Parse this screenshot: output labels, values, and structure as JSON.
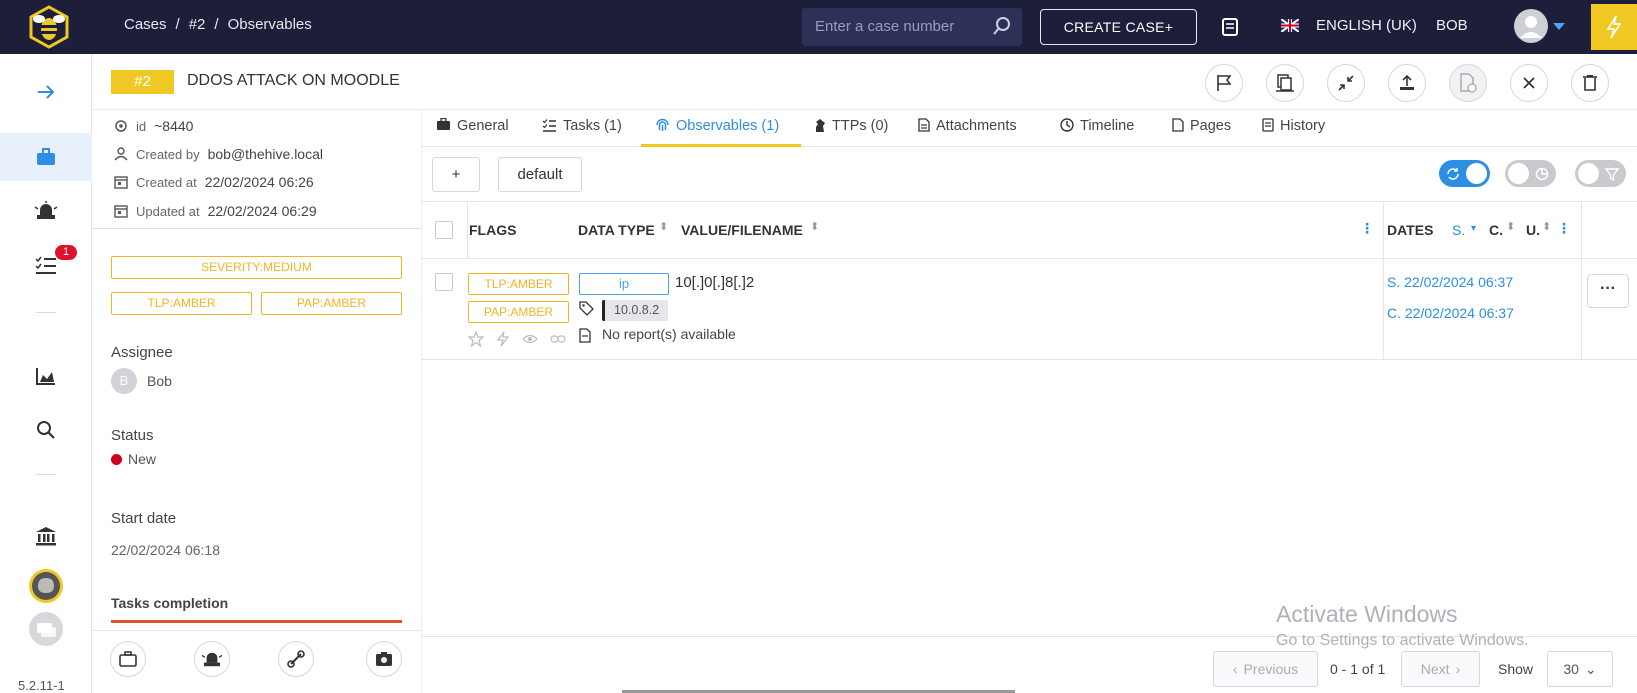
{
  "topbar": {
    "breadcrumb": [
      "Cases",
      "/",
      "#2",
      "/",
      "Observables"
    ],
    "search_placeholder": "Enter a case number",
    "create_case_label": "CREATE CASE+",
    "language": "ENGLISH (UK)",
    "user": "BOB"
  },
  "sidebar": {
    "tasks_badge": "1",
    "version": "5.2.11-1"
  },
  "case": {
    "number": "#2",
    "title": "DDOS ATTACK ON MOODLE"
  },
  "details": {
    "id_label": "id",
    "id_value": "~8440",
    "created_by_label": "Created by",
    "created_by_value": "bob@thehive.local",
    "created_at_label": "Created at",
    "created_at_value": "22/02/2024 06:26",
    "updated_at_label": "Updated at",
    "updated_at_value": "22/02/2024 06:29",
    "severity_tag": "SEVERITY:MEDIUM",
    "tlp_tag": "TLP:AMBER",
    "pap_tag": "PAP:AMBER",
    "assignee_label": "Assignee",
    "assignee_initial": "B",
    "assignee_name": "Bob",
    "status_label": "Status",
    "status_value": "New",
    "start_date_label": "Start date",
    "start_date_value": "22/02/2024 06:18",
    "tasks_completion_label": "Tasks completion"
  },
  "tabs": [
    {
      "label": "General"
    },
    {
      "label": "Tasks (1)"
    },
    {
      "label": "Observables (1)"
    },
    {
      "label": "TTPs (0)"
    },
    {
      "label": "Attachments"
    },
    {
      "label": "Timeline"
    },
    {
      "label": "Pages"
    },
    {
      "label": "History"
    }
  ],
  "toolbar": {
    "add_label": "+",
    "default_label": "default"
  },
  "table": {
    "headers": {
      "flags": "FLAGS",
      "data_type": "DATA TYPE",
      "value": "VALUE/FILENAME",
      "dates": "DATES",
      "s": "S.",
      "c": "C.",
      "u": "U."
    },
    "rows": [
      {
        "tlp": "TLP:AMBER",
        "pap": "PAP:AMBER",
        "data_type": "ip",
        "value": "10[.]0[.]8[.]2",
        "tag": "10.0.8.2",
        "report": "No report(s) available",
        "start_date": "S. 22/02/2024 06:37",
        "created_date": "C. 22/02/2024 06:37"
      }
    ]
  },
  "pagination": {
    "previous": "Previous",
    "info": "0 - 1 of 1",
    "next": "Next",
    "show_label": "Show",
    "page_size": "30"
  },
  "watermark": {
    "line1": "Activate Windows",
    "line2": "Go to Settings to activate Windows."
  },
  "colors": {
    "topbar": "#1c1e3a",
    "accent_yellow": "#f0c824",
    "link_blue": "#2d8fe3",
    "amber": "#f0b429",
    "status_new": "#d0021b"
  }
}
